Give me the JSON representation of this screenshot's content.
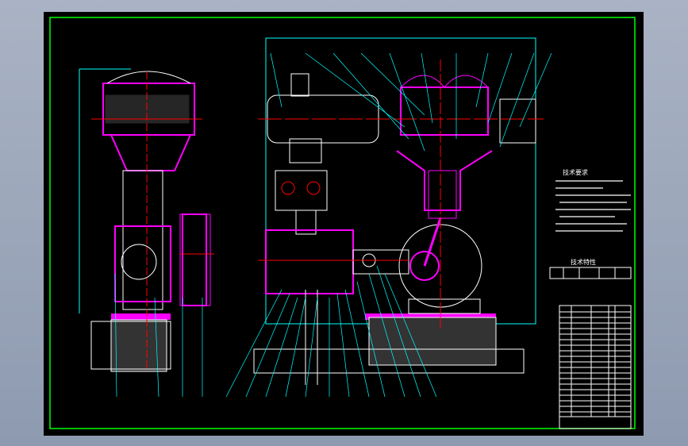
{
  "drawing": {
    "tech_requirements_title": "技术要求",
    "tech_spec_title": "技术特性",
    "colors": {
      "background": "#000000",
      "frame": "#00ff00",
      "outline": "#ffffff",
      "section": "#ff00ff",
      "leader": "#00ffff",
      "centerline": "#ff0000"
    }
  }
}
